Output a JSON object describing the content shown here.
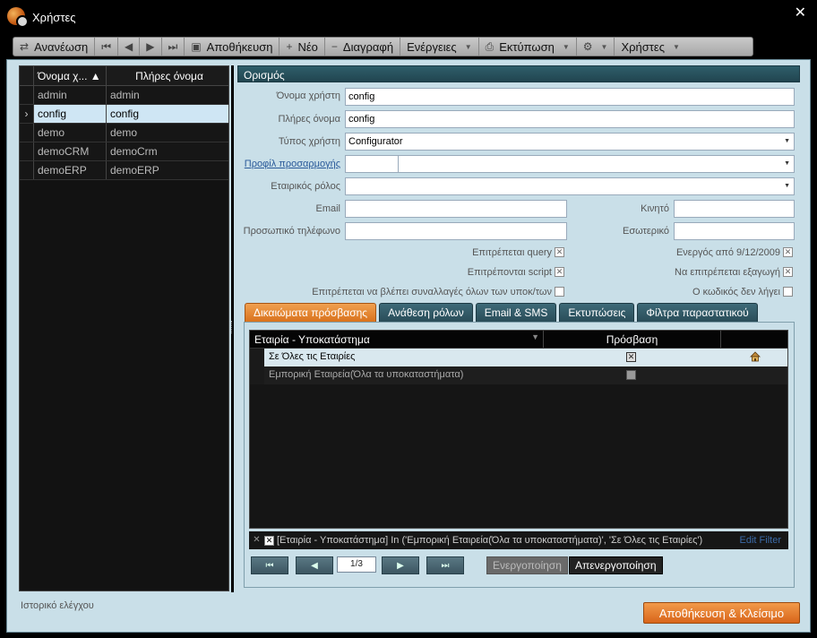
{
  "window": {
    "title": "Χρήστες"
  },
  "toolbar": {
    "refresh": "Ανανέωση",
    "save": "Αποθήκευση",
    "new": "Νέο",
    "delete": "Διαγραφή",
    "actions": "Ενέργειες",
    "print": "Εκτύπωση",
    "users": "Χρήστες"
  },
  "users_grid": {
    "col_username": "Όνομα χ...",
    "col_fullname": "Πλήρες όνομα",
    "rows": [
      {
        "username": "admin",
        "fullname": "admin"
      },
      {
        "username": "config",
        "fullname": "config"
      },
      {
        "username": "demo",
        "fullname": "demo"
      },
      {
        "username": "demoCRM",
        "fullname": "demoCrm"
      },
      {
        "username": "demoERP",
        "fullname": "demoERP"
      }
    ]
  },
  "definition": {
    "header": "Ορισμός",
    "username_label": "Όνομα χρήστη",
    "username_value": "config",
    "fullname_label": "Πλήρες όνομα",
    "fullname_value": "config",
    "usertype_label": "Τύπος χρήστη",
    "usertype_value": "Configurator",
    "profile_label": "Προφίλ προσαρμογής",
    "role_label": "Εταιρικός ρόλος",
    "email_label": "Email",
    "mobile_label": "Κινητό",
    "personal_phone_label": "Προσωπικό τηλέφωνο",
    "internal_label": "Εσωτερικό",
    "allow_query_label": "Επιτρέπεται query",
    "active_from_label": "Ενεργός από 9/12/2009",
    "allow_script_label": "Επιτρέπονται script",
    "allow_export_label": "Να επιτρέπεται εξαγωγή",
    "view_all_label": "Επιτρέπεται να βλέπει συναλλαγές όλων των υποκ/των",
    "pwd_no_expire_label": "Ο κωδικός δεν λήγει"
  },
  "tabs": [
    "Δικαιώματα πρόσβασης",
    "Ανάθεση ρόλων",
    "Email & SMS",
    "Εκτυπώσεις",
    "Φίλτρα παραστατικού"
  ],
  "access_grid": {
    "col_company": "Εταιρία - Υποκατάστημα",
    "col_access": "Πρόσβαση",
    "rows": [
      {
        "company": "Σε Όλες τις Εταιρίες",
        "access": true
      },
      {
        "company": "Εμπορική Εταιρεία(Όλα τα υποκαταστήματα)",
        "access": false
      }
    ],
    "filter_text": "[Εταιρία - Υποκατάστημα] In ('Εμπορική Εταιρεία(Όλα τα υποκαταστήματα)', 'Σε Όλες τις Εταιρίες')",
    "edit_filter": "Edit Filter",
    "page": "1/3",
    "activate": "Ενεργοποίηση",
    "deactivate": "Απενεργοποίηση"
  },
  "footer": {
    "audit_history": "Ιστορικό ελέγχου",
    "save_close": "Αποθήκευση & Κλείσιμο"
  }
}
